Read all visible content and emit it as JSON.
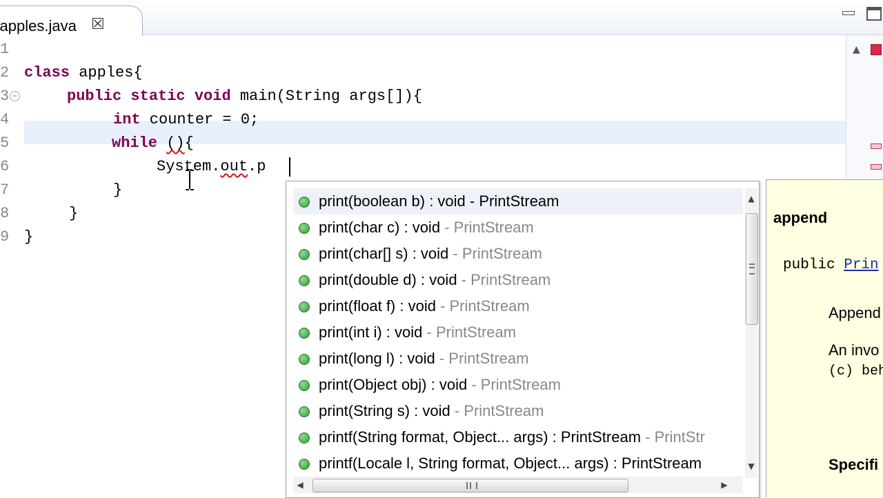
{
  "tab": {
    "title": "*apples.java",
    "close_glyph": "☒"
  },
  "editor": {
    "lines": [
      {
        "n": "1",
        "text": ""
      },
      {
        "n": "2",
        "text": "class apples{"
      },
      {
        "n": "3",
        "text": "    public static void main(String args[]){"
      },
      {
        "n": "4",
        "text": "        int counter = 0;"
      },
      {
        "n": "5",
        "text": "        while ()"
      },
      {
        "n": "6",
        "text": "            System.out.p"
      },
      {
        "n": "7",
        "text": "        }"
      },
      {
        "n": "8",
        "text": "    }"
      },
      {
        "n": "9",
        "text": "}"
      }
    ],
    "tokens": {
      "class_kw": "class",
      "class_name": " apples{",
      "public_kw": "public",
      "static_kw": "static",
      "void_kw": "void",
      "main_rest": " main(String args[]){",
      "int_kw": "int",
      "counter_rest": " counter = 0;",
      "while_kw": "while",
      "while_paren": "()",
      "while_brace": "{",
      "sys": "System.",
      "out": "out",
      "dot_p": ".p",
      "close7": "}",
      "close8": "}",
      "close9": "}"
    }
  },
  "assist": {
    "proposals": [
      {
        "sig": "print(boolean b) : void",
        "qual": " - PrintStream",
        "selected": true
      },
      {
        "sig": "print(char c) : void",
        "qual": " - PrintStream"
      },
      {
        "sig": "print(char[] s) : void",
        "qual": " - PrintStream"
      },
      {
        "sig": "print(double d) : void",
        "qual": " - PrintStream"
      },
      {
        "sig": "print(float f) : void",
        "qual": " - PrintStream"
      },
      {
        "sig": "print(int i) : void",
        "qual": " - PrintStream"
      },
      {
        "sig": "print(long l) : void",
        "qual": " - PrintStream"
      },
      {
        "sig": "print(Object obj) : void",
        "qual": " - PrintStream"
      },
      {
        "sig": "print(String s) : void",
        "qual": " - PrintStream"
      },
      {
        "sig": "printf(String format, Object... args) : PrintStream",
        "qual": " - PrintStr"
      },
      {
        "sig": "printf(Locale l, String format, Object... args) : PrintStream",
        "qual": ""
      }
    ]
  },
  "doc": {
    "title": "append",
    "sig_prefix": "public ",
    "sig_link": "Prin",
    "p1": "Append",
    "p2": "An invo",
    "p3": "(c) beh",
    "spec": "Specifi"
  },
  "scroll": {
    "up": "▲",
    "down": "▼",
    "left": "◀",
    "right": "▶"
  }
}
